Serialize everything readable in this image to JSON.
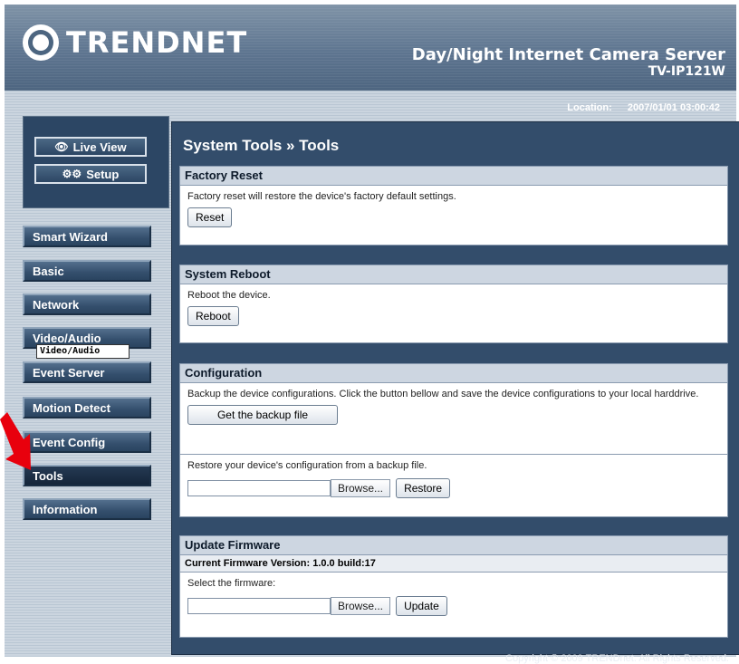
{
  "header": {
    "logo_text": "TRENDNET",
    "product_title": "Day/Night Internet Camera Server",
    "model": "TV-IP121W",
    "location_label": "Location:",
    "datetime": "2007/01/01 03:00:42"
  },
  "top_buttons": {
    "live_view": "Live View",
    "setup": "Setup"
  },
  "menu": [
    {
      "label": "Smart Wizard"
    },
    {
      "label": "Basic"
    },
    {
      "label": "Network"
    },
    {
      "label": "Video/Audio"
    },
    {
      "label": "Event Server"
    },
    {
      "label": "Motion Detect"
    },
    {
      "label": "Event Config"
    },
    {
      "label": "Tools"
    },
    {
      "label": "Information"
    }
  ],
  "tooltip": "Video/Audio",
  "main": {
    "title": "System Tools » Tools",
    "factory_reset": {
      "heading": "Factory Reset",
      "description": "Factory reset will restore the device's factory default settings.",
      "button": "Reset"
    },
    "system_reboot": {
      "heading": "System Reboot",
      "description": "Reboot the device.",
      "button": "Reboot"
    },
    "configuration": {
      "heading": "Configuration",
      "description": "Backup the device configurations. Click the button bellow and save the device configurations to your local harddrive.",
      "backup_button": "Get the backup file",
      "restore_description": "Restore your device's configuration from a backup file.",
      "browse_button": "Browse...",
      "restore_button": "Restore"
    },
    "update_firmware": {
      "heading": "Update Firmware",
      "current_version": "Current Firmware Version: 1.0.0 build:17",
      "select_label": "Select the firmware:",
      "browse_button": "Browse...",
      "update_button": "Update"
    }
  },
  "footer": {
    "copyright": "Copyright © 2009 TRENDnet. All Rights Reserved."
  },
  "colors": {
    "navy_panel": "#334d6b",
    "arrow": "#e8000d",
    "section_header": "#cdd6e1"
  }
}
